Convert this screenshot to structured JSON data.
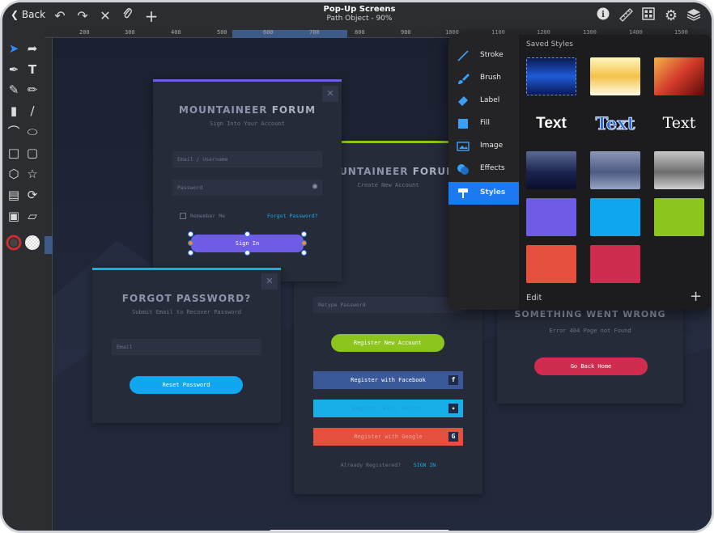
{
  "header": {
    "back_label": "Back",
    "title": "Pop-Up Screens",
    "subtitle": "Path Object - 90%"
  },
  "ruler": {
    "ticks": [
      "200",
      "300",
      "400",
      "500",
      "600",
      "700",
      "800",
      "900",
      "1000",
      "1100",
      "1200",
      "1300",
      "1400",
      "1500"
    ]
  },
  "canvas": {
    "login": {
      "brand_a": "MOUNTAINEER",
      "brand_b": "FORUM",
      "subtitle": "Sign Into Your Account",
      "email_placeholder": "Email / Username",
      "password_placeholder": "Password",
      "remember": "Remember Me",
      "forgot": "Forgot Password?",
      "sign_in": "Sign In"
    },
    "register": {
      "brand_a": "MOUNTAINEER",
      "brand_b": "FORUM",
      "subtitle": "Create New Account",
      "retype": "Retype Password",
      "register_btn": "Register New Account",
      "facebook": "Register with Facebook",
      "twitter": "Register with Twitter",
      "google": "Register with Google",
      "already": "Already Registered?",
      "sign_in": "SIGN IN"
    },
    "forgot": {
      "title": "FORGOT PASSWORD?",
      "subtitle": "Submit Email to Recover Password",
      "email": "Email",
      "reset": "Reset Password"
    },
    "error": {
      "title": "SOMETHING WENT WRONG",
      "subtitle": "Error 404 Page not Found",
      "home": "Go Back Home"
    }
  },
  "popup": {
    "menu": [
      {
        "label": "Stroke",
        "icon": "stroke-icon"
      },
      {
        "label": "Brush",
        "icon": "brush-icon"
      },
      {
        "label": "Label",
        "icon": "label-icon"
      },
      {
        "label": "Fill",
        "icon": "fill-icon"
      },
      {
        "label": "Image",
        "icon": "image-icon"
      },
      {
        "label": "Effects",
        "icon": "effects-icon"
      },
      {
        "label": "Styles",
        "icon": "styles-icon"
      }
    ],
    "saved_styles_title": "Saved Styles",
    "text_samples": [
      "Text",
      "Text",
      "Text"
    ],
    "edit_label": "Edit",
    "colors": {
      "accent_blue": "#1b7af0",
      "purple": "#6f5ce6",
      "cyan": "#10a6f0",
      "green": "#8cc51e",
      "orange_red": "#e4503b",
      "crimson": "#d02c50"
    }
  }
}
